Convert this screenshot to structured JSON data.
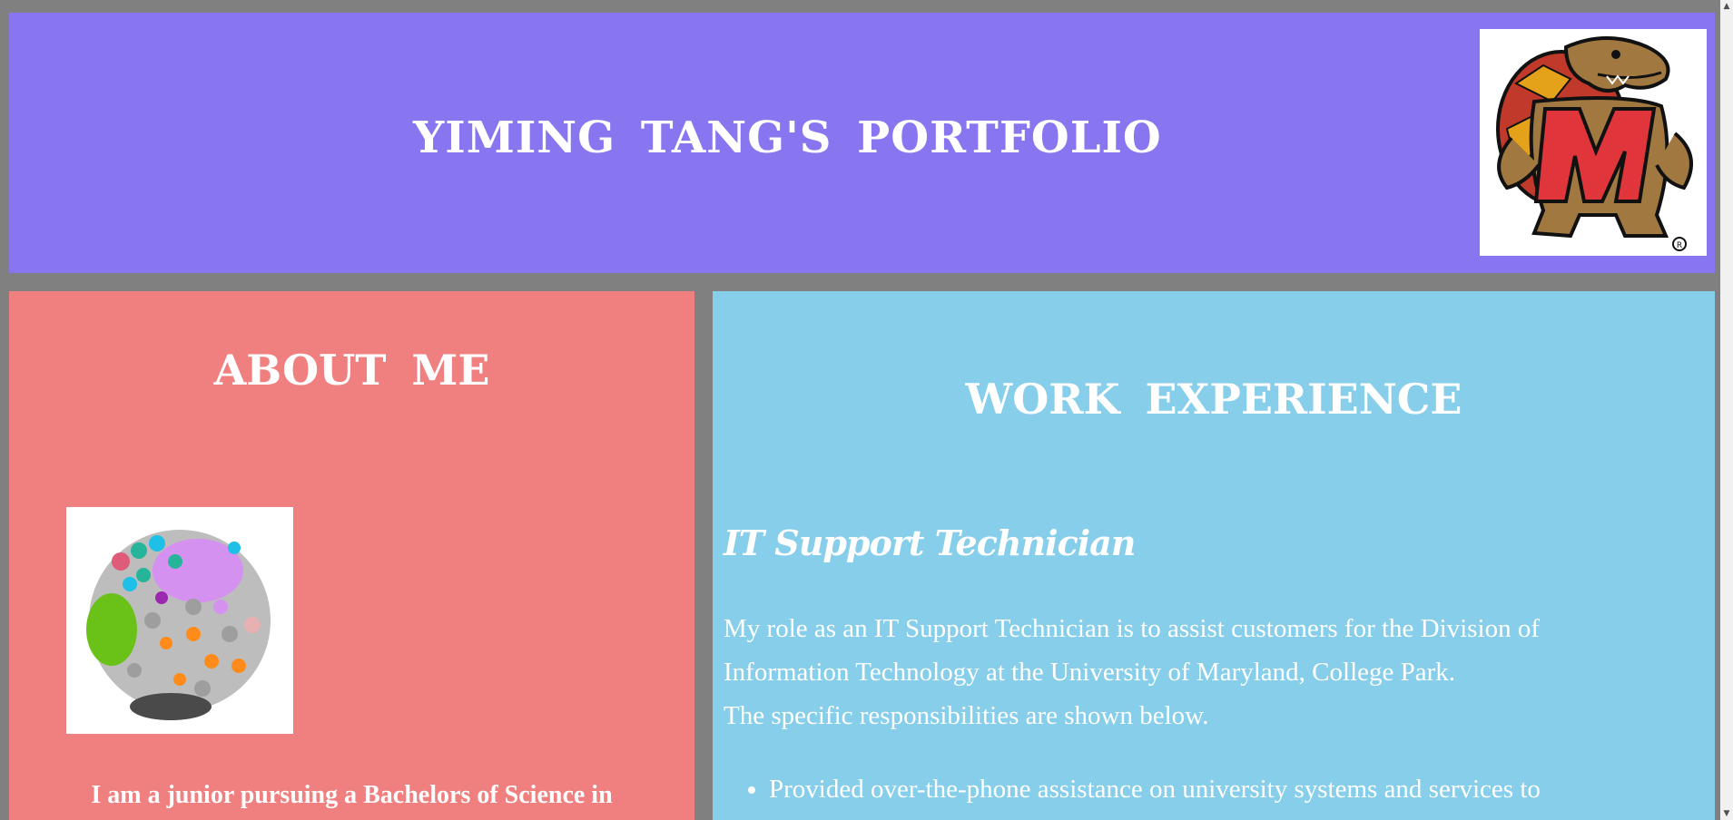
{
  "header": {
    "title": "YIMING TANG'S PORTFOLIO",
    "logo_icon": "maryland-terrapin-logo-icon",
    "background": "#8875f0"
  },
  "about": {
    "heading": "ABOUT ME",
    "image_icon": "network-cluster-graph-image",
    "intro_text": "I am a junior pursuing a Bachelors of Science in",
    "background": "#f08080"
  },
  "work": {
    "heading": "WORK EXPERIENCE",
    "job_title": "IT Support Technician",
    "description": {
      "line1": "My role as an IT Support Technician is to assist customers for the Division of",
      "line2": "Information Technology at the University of Maryland, College Park.",
      "line3": "The specific responsibilities are shown below."
    },
    "responsibilities": [
      "Provided over-the-phone assistance on university systems and services to"
    ],
    "background": "#87ceeb"
  },
  "page": {
    "background": "#808080"
  }
}
